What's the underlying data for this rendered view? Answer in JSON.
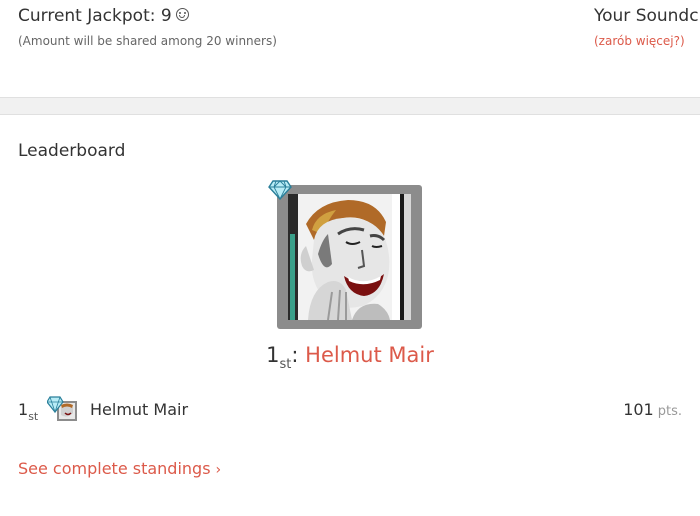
{
  "jackpot": {
    "label": "Current Jackpot: 9",
    "icon": "smiley-face-icon",
    "note": "(Amount will be shared among 20 winners)"
  },
  "sound": {
    "title": "Your Soundc",
    "link": "(zarób więcej?)"
  },
  "leaderboard": {
    "title": "Leaderboard",
    "winner": {
      "rank": "1",
      "rank_suffix": "st",
      "separator": ": ",
      "name": "Helmut Mair",
      "badge_icon": "diamond-icon"
    },
    "rows": [
      {
        "rank": "1",
        "rank_suffix": "st",
        "name": "Helmut Mair",
        "points": "101",
        "points_unit": "pts."
      }
    ],
    "see_all": "See complete standings",
    "see_all_icon": "chevron-right-icon"
  },
  "colors": {
    "accent": "#dc5a4a",
    "text": "#333333",
    "muted": "#666666",
    "divider": "#f1f1f1",
    "frame": "#8c8c8c"
  }
}
